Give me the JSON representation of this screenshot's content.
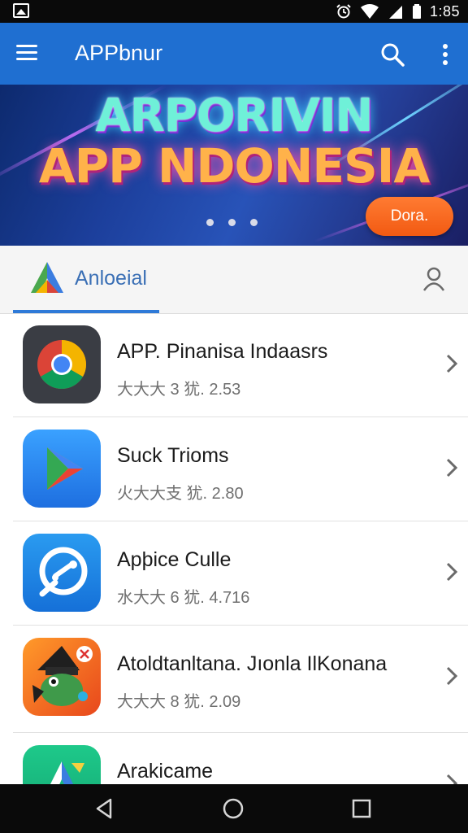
{
  "status_bar": {
    "time": "1:85"
  },
  "app_bar": {
    "title": "APPbnur",
    "icons": {
      "menu": "menu-icon",
      "search": "search-icon",
      "more": "more-vert-icon"
    }
  },
  "banner": {
    "line1": "ARPORIVIN",
    "line2": "APP NDONESIA",
    "cta_label": "Dora.",
    "page_dots": 3
  },
  "tab_header": {
    "label": "Anloeial",
    "icons": {
      "logo": "a-logo-icon",
      "profile": "person-icon"
    }
  },
  "apps": [
    {
      "name": "APP. Pinanisa Indaasrs",
      "meta": "大大大 3 犹. 2.53",
      "icon": "chrome-icon"
    },
    {
      "name": "Suck Trioms",
      "meta": "火大大支 犹. 2.80",
      "icon": "play-store-icon"
    },
    {
      "name": "Apþice Culle",
      "meta": "水大大 6 犹. 4.716",
      "icon": "chat-bubble-icon"
    },
    {
      "name": "Atoldtanltana. Jıonla IlKonana",
      "meta": "大大大 8 犹. 2.09",
      "icon": "game-character-icon"
    },
    {
      "name": "Arakicame",
      "meta": "",
      "icon": "a-logo-icon"
    }
  ],
  "colors": {
    "app_bar": "#1f6fd1",
    "tab_accent": "#2e7ad8",
    "cta": "#f25a12",
    "status_bar": "#0a0a0a"
  }
}
